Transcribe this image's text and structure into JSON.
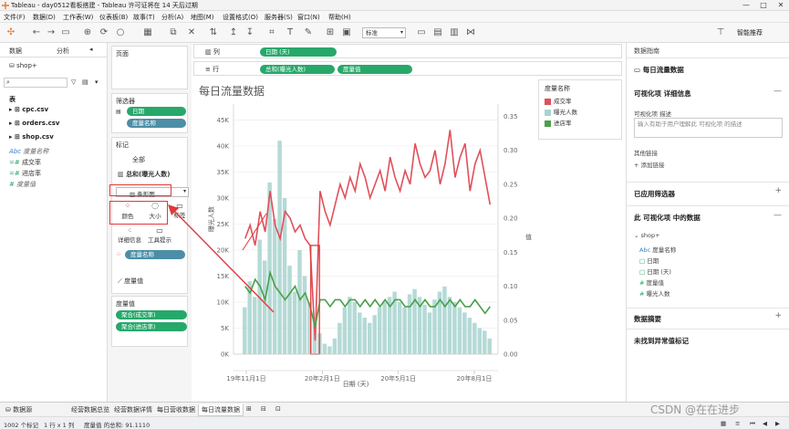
{
  "window": {
    "title": "Tableau - day0512看板搭建 - Tableau 许可证将在 14 天后过期",
    "controls": [
      "—",
      "□",
      "✕"
    ]
  },
  "menu": [
    "文件(F)",
    "数据(D)",
    "工作表(W)",
    "仪表板(B)",
    "故事(T)",
    "分析(A)",
    "地图(M)",
    "设置格式(O)",
    "服务器(S)",
    "窗口(N)",
    "帮助(H)"
  ],
  "toolbar": {
    "select_value": "标准",
    "smart_recommend": "智能推荐"
  },
  "left_pane": {
    "tabs": [
      "数据",
      "分析"
    ],
    "datasource": "shop+",
    "section_table": "表",
    "tables": [
      "cpc.csv",
      "orders.csv",
      "shop.csv"
    ],
    "fields": [
      "度量名称",
      "成交率",
      "进店率",
      "度量值"
    ],
    "field_prefix": [
      "Abc",
      "=#",
      "=#",
      "#"
    ]
  },
  "shelves": {
    "pages": "页面",
    "filters": "筛选器",
    "filter_pills": [
      "日期",
      "度量名称"
    ],
    "marks": "标记",
    "all": "全部",
    "marks_measure": "总和(曝光人数)",
    "mark_type": "条形图",
    "mark_buttons": [
      "颜色",
      "大小",
      "标签",
      "详细信息",
      "工具提示"
    ],
    "color_pill": "度量名称",
    "measure_values": "度量值",
    "measure_values_card": "度量值",
    "mv_pills": [
      "聚合(成交率)",
      "聚合(进店率)"
    ]
  },
  "columns_shelf": {
    "label": "列",
    "pill": "日期 (天)"
  },
  "rows_shelf": {
    "label": "行",
    "pills": [
      "总和(曝光人数)",
      "度量值"
    ]
  },
  "legend": {
    "title": "度量名称",
    "items": [
      {
        "label": "成交率",
        "color": "#e0505a"
      },
      {
        "label": "曝光人数",
        "color": "#a8d4cf"
      },
      {
        "label": "进店率",
        "color": "#4aa04a"
      }
    ]
  },
  "chart_data": {
    "type": "bar",
    "title": "每日流量数据",
    "xlabel": "日期 (天)",
    "ylabel": "曝光人数",
    "y2label": "值",
    "x_ticks": [
      "19年11月1日",
      "20年2月1日",
      "20年5月1日",
      "20年8月1日"
    ],
    "y_left_ticks": [
      "0K",
      "5K",
      "10K",
      "15K",
      "20K",
      "25K",
      "30K",
      "35K",
      "40K",
      "45K"
    ],
    "y_right_ticks": [
      "0.00",
      "0.05",
      "0.10",
      "0.15",
      "0.20",
      "0.25",
      "0.30",
      "0.35"
    ],
    "ylim": [
      0,
      47000
    ],
    "y2lim": [
      0,
      0.36
    ],
    "series": [
      {
        "name": "曝光人数",
        "type": "bar",
        "color": "#a8d4cf",
        "values": [
          9000,
          14000,
          11000,
          22000,
          18000,
          33000,
          26000,
          41000,
          30000,
          17000,
          12000,
          20000,
          15000,
          10000,
          7000,
          4000,
          2000,
          1500,
          3000,
          6000,
          9000,
          11000,
          10000,
          8000,
          7000,
          6000,
          7500,
          9000,
          10000,
          11000,
          12000,
          10000,
          9000,
          11500,
          12500,
          11000,
          9500,
          8000,
          10500,
          12000,
          13000,
          11000,
          10000,
          9000,
          8000,
          7000,
          6000,
          5000,
          4500,
          3000
        ]
      },
      {
        "name": "成交率",
        "type": "line",
        "color": "#e0505a",
        "values": [
          0.17,
          0.19,
          0.16,
          0.21,
          0.18,
          0.24,
          0.19,
          0.17,
          0.21,
          0.2,
          0.18,
          0.19,
          0.17,
          0.16,
          0.02,
          0.24,
          0.21,
          0.19,
          0.22,
          0.25,
          0.23,
          0.26,
          0.24,
          0.28,
          0.26,
          0.23,
          0.25,
          0.27,
          0.24,
          0.29,
          0.26,
          0.24,
          0.27,
          0.25,
          0.31,
          0.28,
          0.26,
          0.27,
          0.3,
          0.25,
          0.28,
          0.33,
          0.26,
          0.29,
          0.31,
          0.24,
          0.28,
          0.3,
          0.26,
          0.22
        ]
      },
      {
        "name": "进店率",
        "type": "line",
        "color": "#4aa04a",
        "values": [
          0.1,
          0.09,
          0.11,
          0.1,
          0.08,
          0.12,
          0.1,
          0.09,
          0.08,
          0.09,
          0.1,
          0.08,
          0.09,
          0.07,
          0.04,
          0.08,
          0.08,
          0.07,
          0.08,
          0.08,
          0.07,
          0.08,
          0.08,
          0.07,
          0.08,
          0.07,
          0.08,
          0.07,
          0.08,
          0.07,
          0.08,
          0.08,
          0.07,
          0.07,
          0.08,
          0.07,
          0.08,
          0.07,
          0.07,
          0.08,
          0.07,
          0.08,
          0.07,
          0.08,
          0.07,
          0.07,
          0.08,
          0.07,
          0.06,
          0.07
        ]
      }
    ]
  },
  "right_pane": {
    "header": "数据指南",
    "viz_title": "每日流量数据",
    "viz_details": "可视化项 详细信息",
    "desc_label": "可视化项 描述",
    "desc_placeholder": "输入有助于用户理解此 可视化项 的描述",
    "links_label": "其他链接",
    "add_link": "添加链接",
    "applied_filters": "已应用筛选器",
    "data_in_viz": "此 可视化项 中的数据",
    "ds": "shop+",
    "ds_fields": [
      "度量名称",
      "日期",
      "日期 (天)",
      "度量值",
      "曝光人数"
    ],
    "ds_prefix": [
      "Abc",
      "□",
      "□",
      "#",
      "#"
    ],
    "data_summary": "数据摘要",
    "no_anomaly": "未找到异常值标记"
  },
  "bottom_tabs": [
    "数据源",
    "经营数据总览",
    "经营数据详情",
    "每日营收数据",
    "每日流量数据"
  ],
  "status": {
    "marks": "1002 个标记",
    "rowcol": "1 行 x 1 列",
    "sum": "度量值 的总和: 91.1110"
  },
  "watermark": "CSDN @在在进步"
}
